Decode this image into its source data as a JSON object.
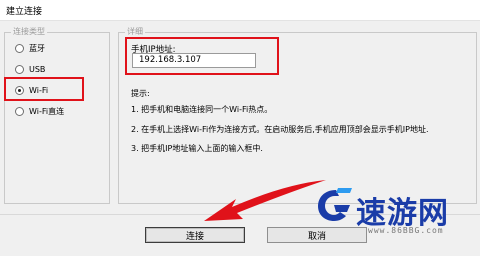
{
  "window": {
    "title": "建立连接"
  },
  "connection_type": {
    "legend": "连接类型",
    "options": [
      {
        "label": "蓝牙",
        "checked": false
      },
      {
        "label": "USB",
        "checked": false
      },
      {
        "label": "Wi-Fi",
        "checked": true
      },
      {
        "label": "Wi-Fi直连",
        "checked": false
      }
    ]
  },
  "details": {
    "legend": "详细",
    "ip_label": "手机IP地址:",
    "ip_value": "192.168.3.107",
    "hint_title": "提示:",
    "hints": [
      "1. 把手机和电脑连接同一个Wi-Fi热点。",
      "2. 在手机上选择Wi-Fi作为连接方式。在启动服务后,手机应用顶部会显示手机IP地址.",
      "3. 把手机IP地址输入上面的输入框中."
    ]
  },
  "buttons": {
    "connect": "连接",
    "cancel": "取消"
  },
  "watermark": {
    "text": "速游网",
    "url": "www.86BBG.com"
  },
  "colors": {
    "highlight": "#e0121a",
    "watermark_blue": "#1a3ca8"
  }
}
